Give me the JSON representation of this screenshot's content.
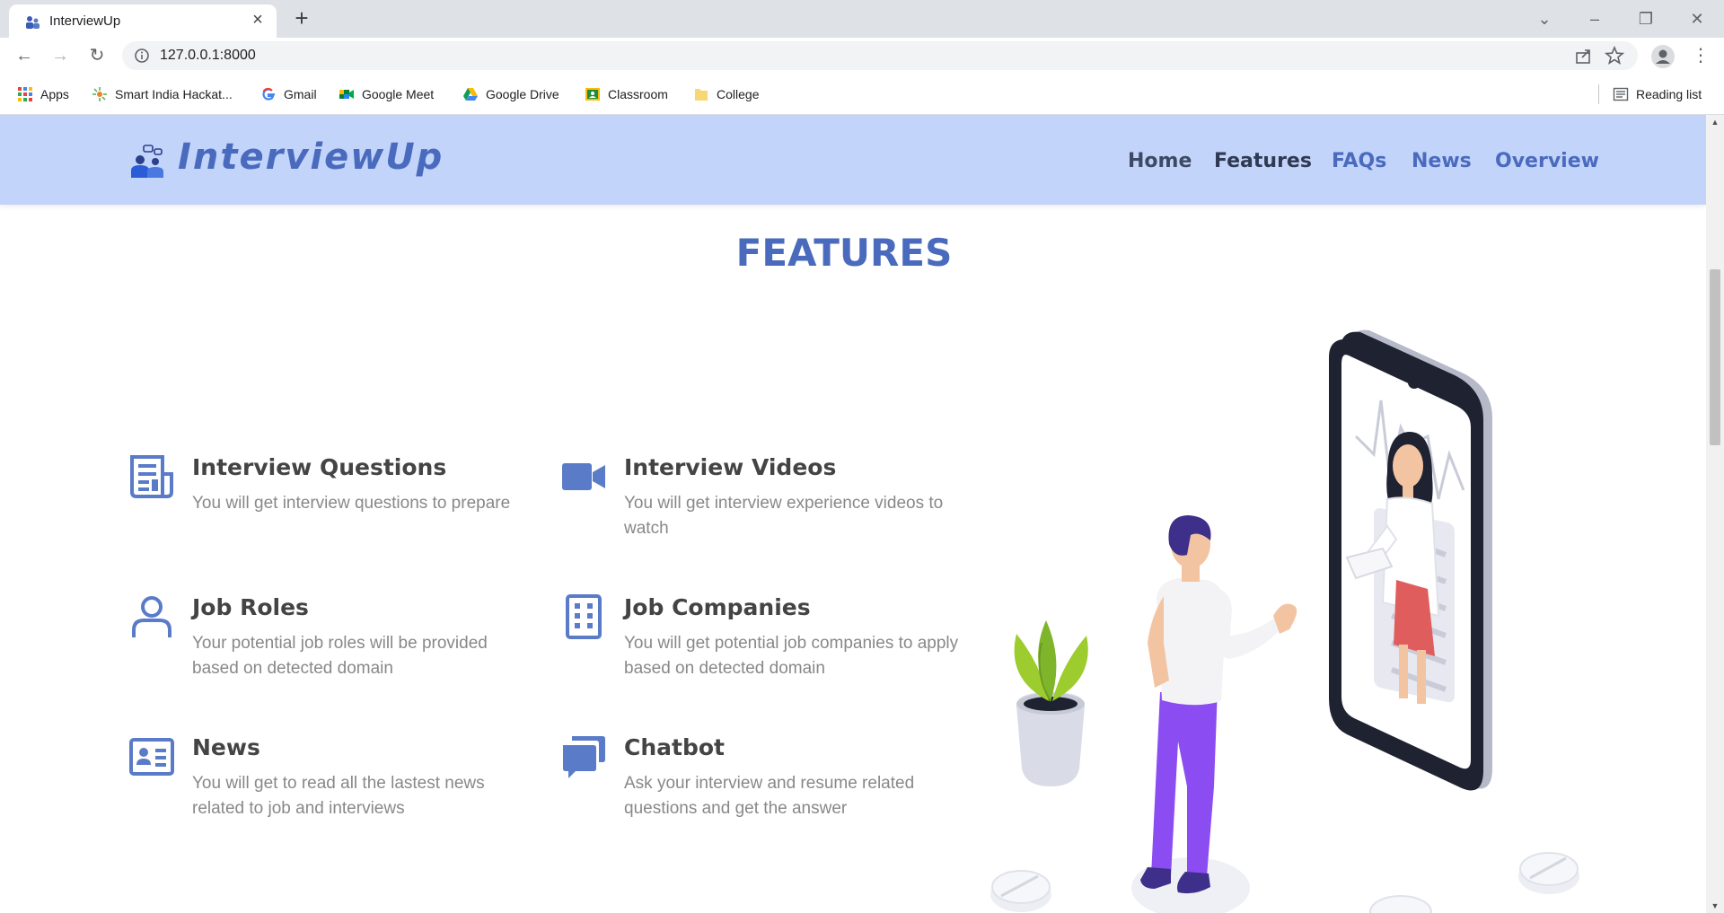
{
  "browser": {
    "tab_title": "InterviewUp",
    "url": "127.0.0.1:8000",
    "bookmarks": [
      {
        "label": "Apps",
        "icon": "apps-grid-icon"
      },
      {
        "label": "Smart India Hackat...",
        "icon": "sih-icon"
      },
      {
        "label": "Gmail",
        "icon": "google-icon"
      },
      {
        "label": "Google Meet",
        "icon": "meet-icon"
      },
      {
        "label": "Google Drive",
        "icon": "drive-icon"
      },
      {
        "label": "Classroom",
        "icon": "classroom-icon"
      },
      {
        "label": "College",
        "icon": "folder-icon"
      }
    ],
    "reading_list": "Reading list"
  },
  "header": {
    "logo_text": "InterviewUp",
    "nav": [
      {
        "label": "Home",
        "color": "#3d4a63"
      },
      {
        "label": "Features",
        "color": "#2f3a52"
      },
      {
        "label": "FAQs",
        "color": "#4a6bbd"
      },
      {
        "label": "News",
        "color": "#4a6bbd"
      },
      {
        "label": "Overview",
        "color": "#4a6bbd"
      }
    ]
  },
  "features_section": {
    "title": "FEATURES",
    "items": [
      {
        "title": "Interview Questions",
        "desc": "You will get interview questions to prepare",
        "icon": "document-icon"
      },
      {
        "title": "Interview Videos",
        "desc": "You will get interview experience videos to watch",
        "icon": "video-camera-icon"
      },
      {
        "title": "Job Roles",
        "desc": "Your potential job roles will be provided based on detected domain",
        "icon": "person-icon"
      },
      {
        "title": "Job Companies",
        "desc": "You will get potential job companies to apply based on detected domain",
        "icon": "building-icon"
      },
      {
        "title": "News",
        "desc": "You will get to read all the lastest news related to job and interviews",
        "icon": "id-card-icon"
      },
      {
        "title": "Chatbot",
        "desc": "Ask your interview and resume related questions and get the answer",
        "icon": "chat-bubbles-icon"
      }
    ]
  },
  "colors": {
    "accent": "#4a6bbd",
    "header_bg": "#c3d4fb",
    "icon_blue": "#5a7bc7"
  }
}
